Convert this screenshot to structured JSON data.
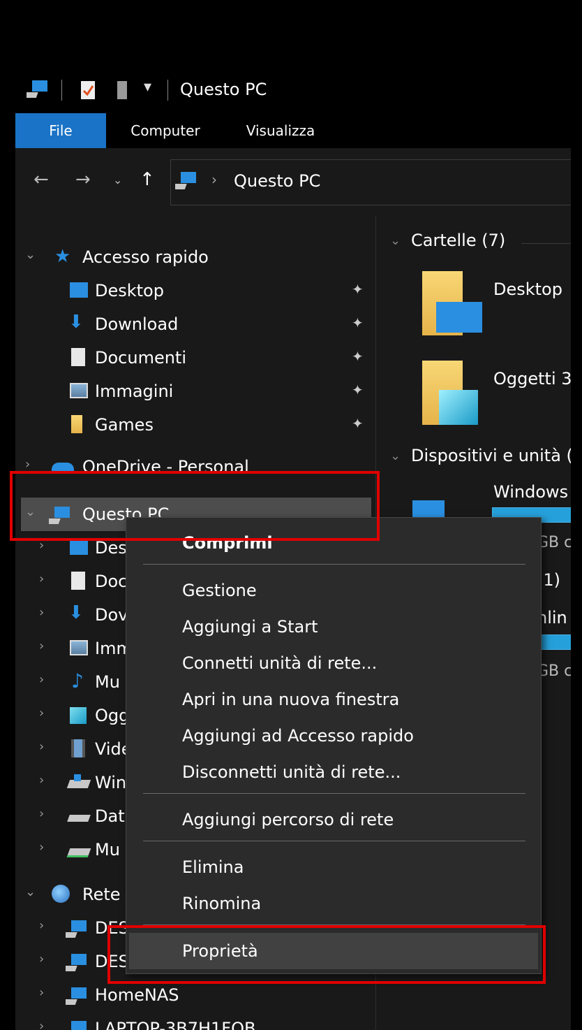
{
  "window": {
    "title": "Questo PC"
  },
  "ribbon": {
    "tabs": [
      {
        "label": "File"
      },
      {
        "label": "Computer"
      },
      {
        "label": "Visualizza"
      }
    ]
  },
  "address": {
    "path": "Questo PC",
    "separator": "›"
  },
  "nav_pane": {
    "quick_access": {
      "label": "Accesso rapido"
    },
    "quick_items": [
      {
        "label": "Desktop"
      },
      {
        "label": "Download"
      },
      {
        "label": "Documenti"
      },
      {
        "label": "Immagini"
      },
      {
        "label": "Games"
      }
    ],
    "onedrive": {
      "label": "OneDrive - Personal"
    },
    "this_pc": {
      "label": "Questo PC"
    },
    "pc_items": [
      {
        "label": "Des"
      },
      {
        "label": "Doc"
      },
      {
        "label": "Dov"
      },
      {
        "label": "Imm"
      },
      {
        "label": "Mu"
      },
      {
        "label": "Ogg"
      },
      {
        "label": "Vide"
      },
      {
        "label": "Win"
      },
      {
        "label": "Dat"
      },
      {
        "label": "Mu"
      }
    ],
    "network": {
      "label": "Rete"
    },
    "net_items": [
      {
        "label": "DES"
      },
      {
        "label": "DES"
      },
      {
        "label": "HomeNAS"
      },
      {
        "label": "LAPTOP-3B7H1FOB"
      }
    ]
  },
  "content": {
    "folders_header": "Cartelle (7)",
    "folders": [
      {
        "label": "Desktop"
      },
      {
        "label": "Oggetti 3"
      }
    ],
    "devices_header": "Dispositivi e unità (",
    "device_label": "Windows",
    "device_size_1": "GB c",
    "network_header": "(1)",
    "network_item": "nlin",
    "device_size_2": "GB c"
  },
  "context_menu": {
    "items": [
      {
        "label": "Comprimi"
      },
      {
        "label": "Gestione"
      },
      {
        "label": "Aggiungi a Start"
      },
      {
        "label": "Connetti unità di rete..."
      },
      {
        "label": "Apri in una nuova finestra"
      },
      {
        "label": "Aggiungi ad Accesso rapido"
      },
      {
        "label": "Disconnetti unità di rete..."
      },
      {
        "label": "Aggiungi percorso di rete"
      },
      {
        "label": "Elimina"
      },
      {
        "label": "Rinomina"
      },
      {
        "label": "Proprietà"
      }
    ]
  },
  "colors": {
    "accent": "#1a73c6",
    "highlight": "#e00000"
  }
}
